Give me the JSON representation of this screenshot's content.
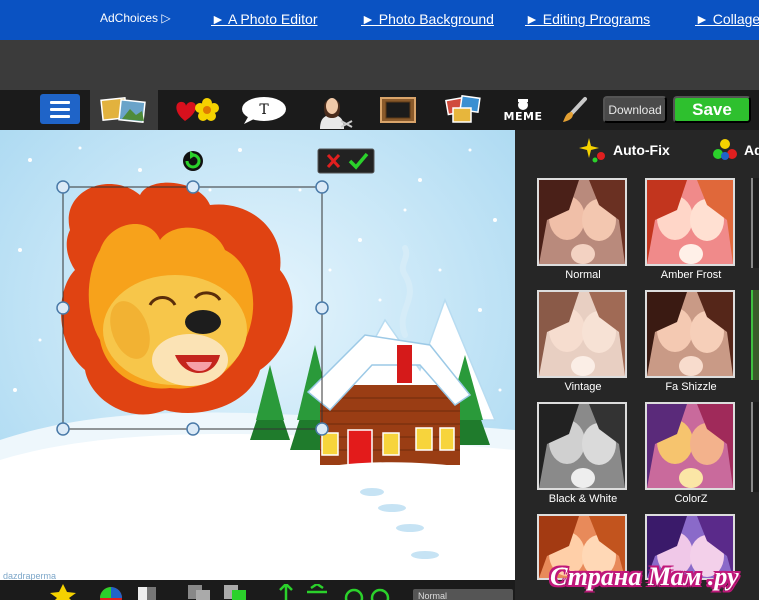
{
  "adbar": {
    "adchoices": "AdChoices ▷",
    "links": [
      "► A Photo Editor",
      "► Photo Background",
      "► Editing Programs",
      "► Collage"
    ]
  },
  "toolbar": {
    "tools": [
      "menu-icon",
      "photos-icon",
      "hearts-flower-icon",
      "text-bubble-icon",
      "cutout-person-icon",
      "frame-icon",
      "collage-icon",
      "meme-icon",
      "brush-icon"
    ],
    "text_bubble": "T",
    "meme_label": "MEME",
    "download_label": "Download",
    "save_label": "Save"
  },
  "canvas": {
    "credit": "dazdraperma"
  },
  "panel": {
    "tabs": {
      "autofix": "Auto-Fix",
      "ad": "Ad"
    },
    "filters": [
      {
        "label": "Normal"
      },
      {
        "label": "Amber Frost"
      },
      {
        "label": "Vintage"
      },
      {
        "label": "Fa Shizzle"
      },
      {
        "label": "Black & White"
      },
      {
        "label": "ColorZ"
      },
      {
        "label": ""
      },
      {
        "label": ""
      }
    ]
  },
  "bottom": {
    "blend_mode": "Normal"
  },
  "watermark": "Страна Мам .ру",
  "colors": {
    "adbar": "#0a52c2",
    "save": "#2ec02e",
    "sky": "#cfe9f7",
    "accent_pink": "#c0177a"
  }
}
